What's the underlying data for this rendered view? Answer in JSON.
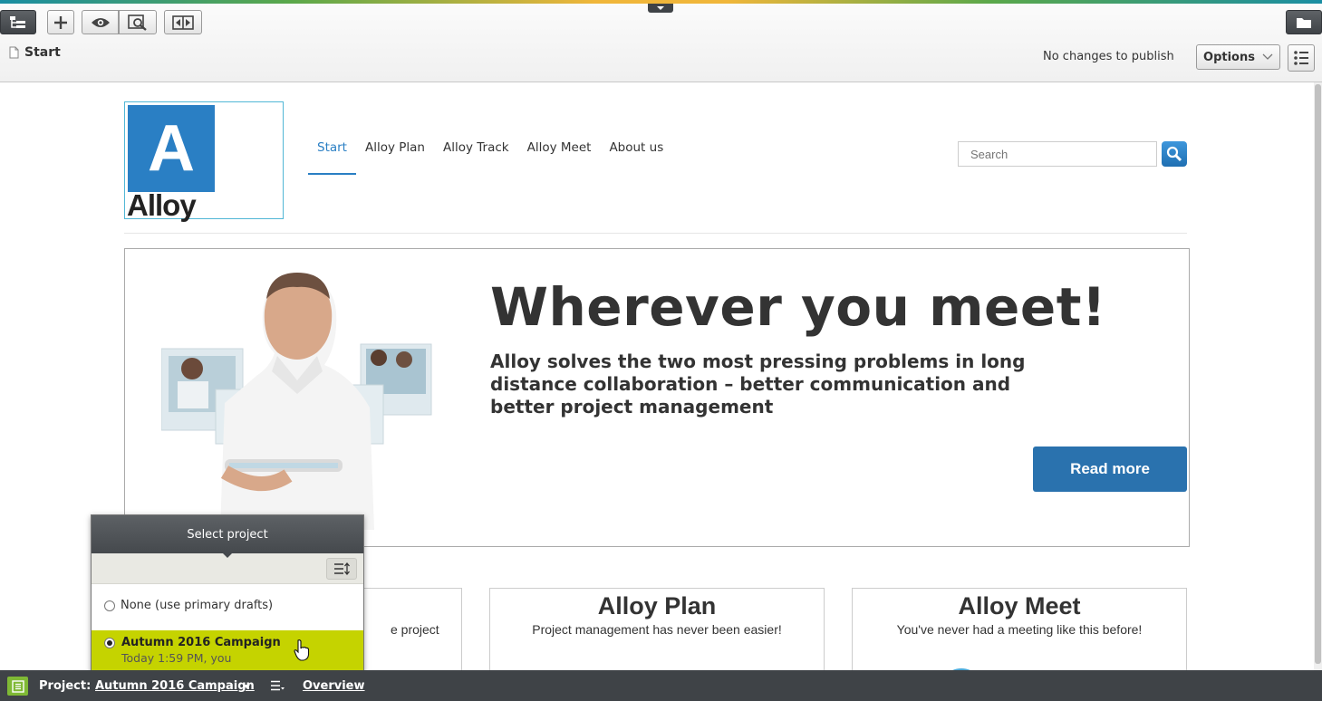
{
  "colors": {
    "accent": "#2a7fc4",
    "project_selected": "#c5d300",
    "bar": "#3f4347",
    "project_icon": "#7fb935"
  },
  "toolbar": {
    "breadcrumb": "Start",
    "status": "No changes to publish",
    "options_label": "Options",
    "icons": [
      "page-tree-icon",
      "add-icon",
      "eye-icon",
      "preview-icon",
      "compare-icon",
      "folder-icon",
      "list-icon"
    ]
  },
  "site": {
    "logo_letter": "A",
    "logo_word": "Alloy",
    "nav": [
      {
        "label": "Start",
        "active": true
      },
      {
        "label": "Alloy Plan"
      },
      {
        "label": "Alloy Track"
      },
      {
        "label": "Alloy Meet"
      },
      {
        "label": "About us"
      }
    ],
    "search_placeholder": "Search"
  },
  "hero": {
    "title": "Wherever you meet!",
    "subtitle": "Alloy solves the two most pressing problems in long distance collaboration – better communication and better project management",
    "cta": "Read more"
  },
  "cards": [
    {
      "title": "",
      "text": "e project"
    },
    {
      "title": "Alloy Plan",
      "text": "Project management has never been easier!"
    },
    {
      "title": "Alloy Meet",
      "text": "You've never had a meeting like this before!"
    }
  ],
  "project_popup": {
    "title": "Select project",
    "options": [
      {
        "label": "None (use primary drafts)",
        "selected": false
      },
      {
        "label": "Autumn 2016 Campaign",
        "meta": "Today 1:59 PM, you",
        "selected": true
      }
    ]
  },
  "project_bar": {
    "label": "Project:",
    "project": "Autumn 2016 Campaign",
    "overview": "Overview"
  }
}
